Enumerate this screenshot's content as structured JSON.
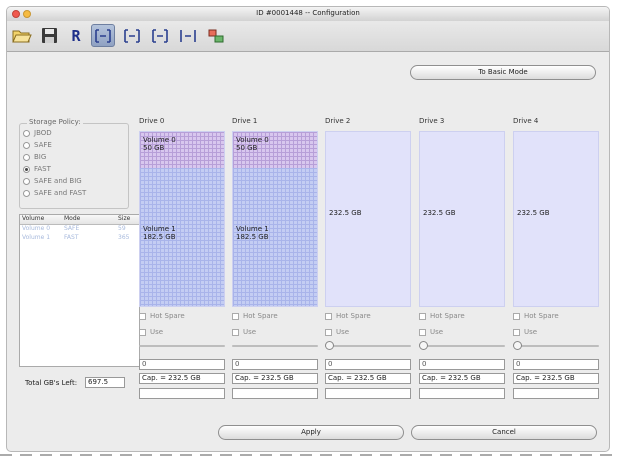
{
  "window": {
    "title": "ID #0001448 -- Configuration"
  },
  "toolbar": {
    "buttons": [
      {
        "icon": "folder-open-icon"
      },
      {
        "icon": "save-disk-icon"
      },
      {
        "icon": "r-letter-icon",
        "glyph": "R"
      },
      {
        "icon": "raid-mode-1-icon",
        "glyph": "[+]"
      },
      {
        "icon": "raid-mode-2-icon",
        "glyph": "[+]"
      },
      {
        "icon": "raid-mode-3-icon",
        "glyph": "[+]"
      },
      {
        "icon": "raid-mode-4-icon",
        "glyph": "[+]"
      },
      {
        "icon": "raid-mode-5-icon",
        "glyph": "[+]"
      }
    ]
  },
  "basic_mode_button": "To Basic Mode",
  "storage_policy": {
    "legend": "Storage Policy:",
    "options": [
      "JBOD",
      "SAFE",
      "BIG",
      "FAST",
      "SAFE and BIG",
      "SAFE and FAST"
    ],
    "selected": "FAST"
  },
  "volumes_table": {
    "headers": [
      "Volume",
      "Mode",
      "Size"
    ],
    "rows": [
      {
        "volume": "Volume 0",
        "mode": "SAFE",
        "size": "59"
      },
      {
        "volume": "Volume 1",
        "mode": "FAST",
        "size": "365"
      }
    ]
  },
  "total_left": {
    "label": "Total GB's Left:",
    "value": "697.5"
  },
  "drives": [
    {
      "name": "Drive 0",
      "vol0": [
        "Volume 0",
        "50 GB"
      ],
      "vol1": [
        "Volume 1",
        "182.5 GB"
      ],
      "free_label": "",
      "hot_spare": "Hot Spare",
      "use": "Use",
      "value": "0",
      "capacity": "Cap. = 232.5 GB",
      "has_thumb": false
    },
    {
      "name": "Drive 1",
      "vol0": [
        "Volume 0",
        "50 GB"
      ],
      "vol1": [
        "Volume 1",
        "182.5 GB"
      ],
      "free_label": "",
      "hot_spare": "Hot Spare",
      "use": "Use",
      "value": "0",
      "capacity": "Cap. = 232.5 GB",
      "has_thumb": false
    },
    {
      "name": "Drive 2",
      "vol0": null,
      "vol1": null,
      "free_label": "232.5 GB",
      "hot_spare": "Hot Spare",
      "use": "Use",
      "value": "0",
      "capacity": "Cap. = 232.5 GB",
      "has_thumb": true
    },
    {
      "name": "Drive 3",
      "vol0": null,
      "vol1": null,
      "free_label": "232.5 GB",
      "hot_spare": "Hot Spare",
      "use": "Use",
      "value": "0",
      "capacity": "Cap. = 232.5 GB",
      "has_thumb": true
    },
    {
      "name": "Drive 4",
      "vol0": null,
      "vol1": null,
      "free_label": "232.5 GB",
      "hot_spare": "Hot Spare",
      "use": "Use",
      "value": "0",
      "capacity": "Cap. = 232.5 GB",
      "has_thumb": true
    }
  ],
  "footer": {
    "apply": "Apply",
    "cancel": "Cancel"
  },
  "colors": {
    "window_bg": "#ececec",
    "drive_free": "#e1e2fa",
    "volume0": "#d8c7ee",
    "volume1": "#c4cdf3",
    "selected_tool": "#9fb0ce"
  }
}
